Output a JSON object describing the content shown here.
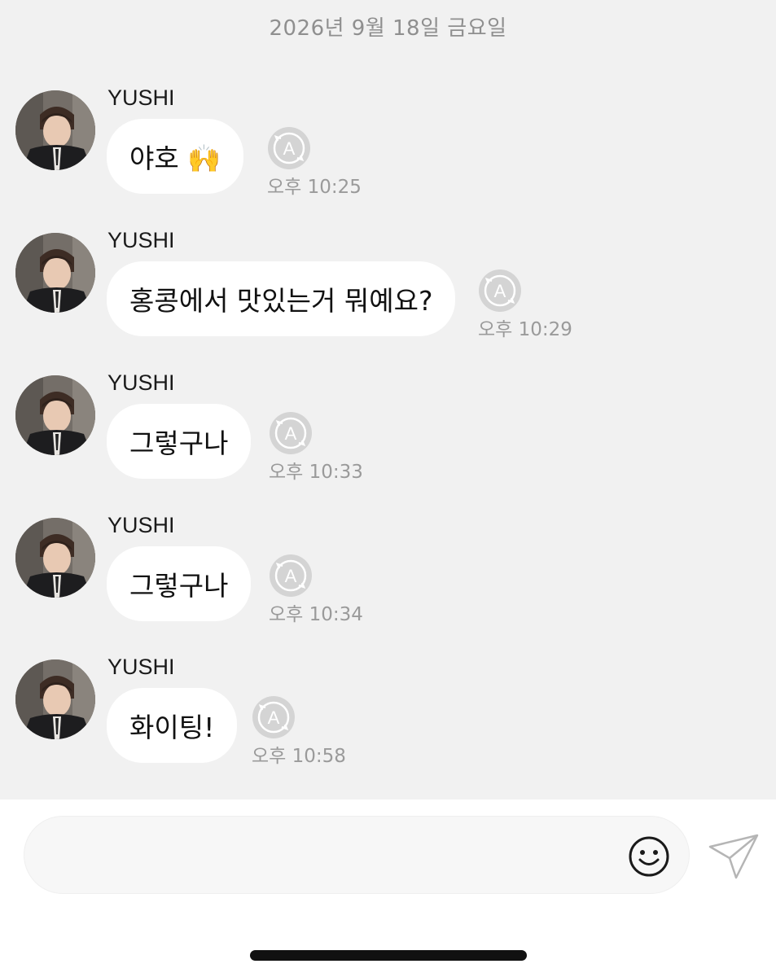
{
  "chat": {
    "date_divider": "2026년 9월 18일 금요일",
    "messages": [
      {
        "sender": "YUSHI",
        "text": "야호 🙌",
        "time": "오후 10:25"
      },
      {
        "sender": "YUSHI",
        "text": "홍콩에서 맛있는거 뭐예요?",
        "time": "오후 10:29"
      },
      {
        "sender": "YUSHI",
        "text": "그렇구나",
        "time": "오후 10:33"
      },
      {
        "sender": "YUSHI",
        "text": "그렇구나",
        "time": "오후 10:34"
      },
      {
        "sender": "YUSHI",
        "text": "화이팅!",
        "time": "오후 10:58"
      }
    ],
    "translate_icon_letter": "A"
  },
  "composer": {
    "input_value": "",
    "input_placeholder": "",
    "emoji_icon": "smiley-face-icon",
    "send_icon": "paper-plane-icon"
  },
  "colors": {
    "chat_background": "#f1f1f1",
    "bubble": "#ffffff",
    "muted_text": "#9a9a9a",
    "icon_gray": "#c9c9c9"
  }
}
